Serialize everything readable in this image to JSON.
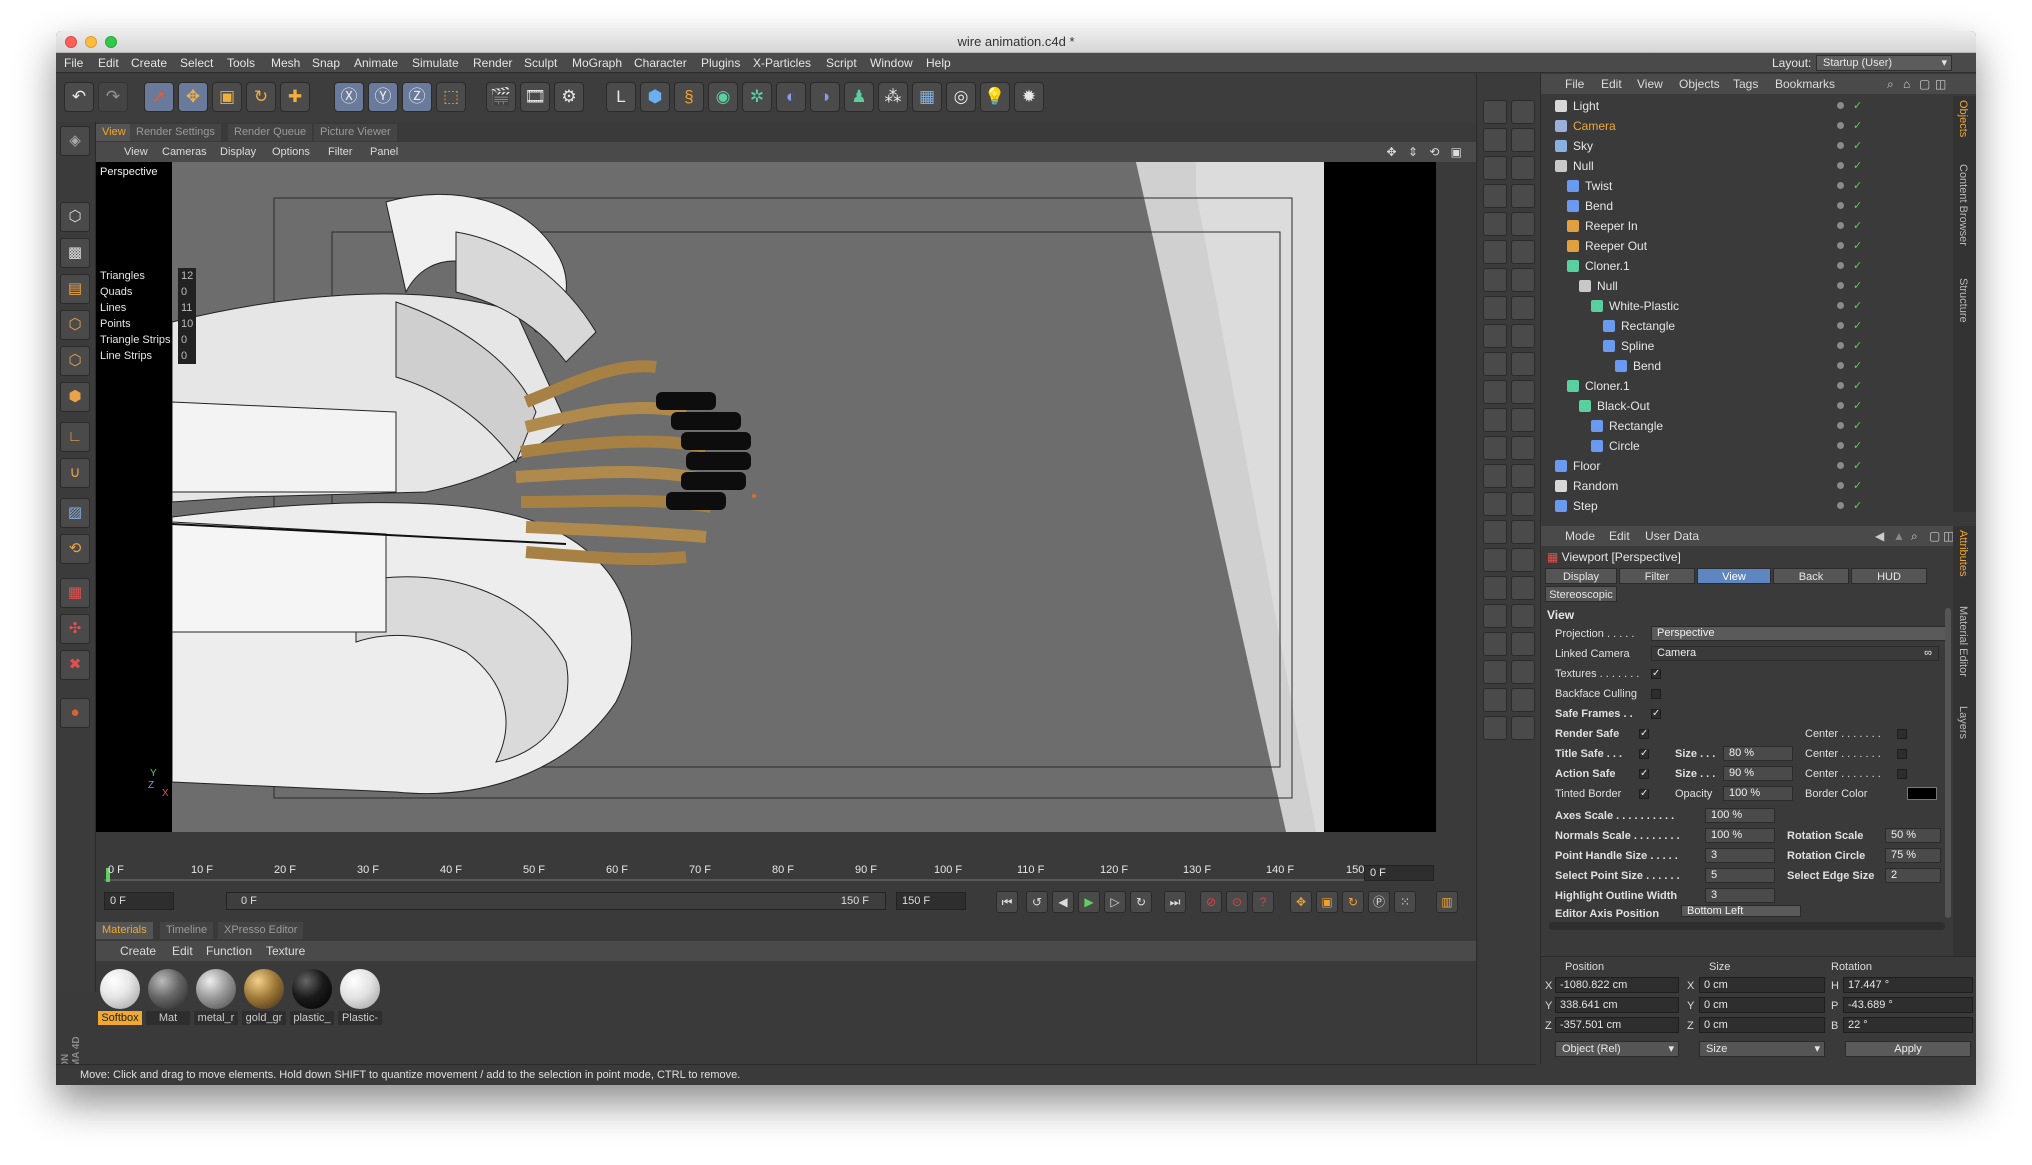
{
  "window": {
    "title": "wire animation.c4d *"
  },
  "menu": [
    "File",
    "Edit",
    "Create",
    "Select",
    "Tools",
    "Mesh",
    "Snap",
    "Animate",
    "Simulate",
    "Render",
    "Sculpt",
    "MoGraph",
    "Character",
    "Plugins",
    "X-Particles",
    "Script",
    "Window",
    "Help"
  ],
  "layout": {
    "label": "Layout:",
    "value": "Startup (User)"
  },
  "viewport_tabs": [
    "View",
    "Render Settings",
    "Render Queue",
    "Picture Viewer"
  ],
  "viewport_menus": [
    "View",
    "Cameras",
    "Display",
    "Options",
    "Filter",
    "Panel"
  ],
  "viewport": {
    "label": "Perspective",
    "stats": [
      {
        "k": "Triangles",
        "v": "12"
      },
      {
        "k": "Quads",
        "v": "0"
      },
      {
        "k": "Lines",
        "v": "11"
      },
      {
        "k": "Points",
        "v": "10"
      },
      {
        "k": "Triangle Strips",
        "v": "0"
      },
      {
        "k": "Line Strips",
        "v": "0"
      }
    ],
    "axis_y": "Y",
    "axis_z": "Z",
    "axis_x": "X"
  },
  "timeline": {
    "ruler": [
      "0 F",
      "10 F",
      "20 F",
      "30 F",
      "40 F",
      "50 F",
      "60 F",
      "70 F",
      "80 F",
      "90 F",
      "100 F",
      "110 F",
      "120 F",
      "130 F",
      "140 F",
      "150"
    ],
    "current_frame": "0 F",
    "start": "0 F",
    "slider_start": "0 F",
    "slider_end": "150 F",
    "end": "150 F"
  },
  "materials": {
    "tabs": [
      "Materials",
      "Timeline",
      "XPresso Editor"
    ],
    "menus": [
      "Create",
      "Edit",
      "Function",
      "Texture"
    ],
    "items": [
      {
        "label": "Softbox",
        "color": "#e8e8e8"
      },
      {
        "label": "Mat",
        "color": "#666666"
      },
      {
        "label": "metal_r",
        "color": "#9a9a9a"
      },
      {
        "label": "gold_gr",
        "color": "#a07a3a"
      },
      {
        "label": "plastic_",
        "color": "#1a1a1a"
      },
      {
        "label": "Plastic-",
        "color": "#e2e2e2"
      }
    ]
  },
  "status": "Move: Click and drag to move elements. Hold down SHIFT to quantize movement / add to the selection in point mode, CTRL to remove.",
  "objects": {
    "menus": [
      "File",
      "Edit",
      "View",
      "Objects",
      "Tags",
      "Bookmarks"
    ],
    "side_tabs": [
      "Objects",
      "Content Browser",
      "Structure"
    ],
    "rows": [
      {
        "name": "Light",
        "level": 0,
        "orange": false,
        "icon": "#d8d8d8"
      },
      {
        "name": "Camera",
        "level": 0,
        "orange": true,
        "icon": "#9ab0d8"
      },
      {
        "name": "Sky",
        "level": 0,
        "orange": false,
        "icon": "#8ab0e0"
      },
      {
        "name": "Null",
        "level": 0,
        "orange": false,
        "icon": "#c8c8c8"
      },
      {
        "name": "Twist",
        "level": 1,
        "orange": false,
        "icon": "#6a9af0"
      },
      {
        "name": "Bend",
        "level": 1,
        "orange": false,
        "icon": "#6a9af0"
      },
      {
        "name": "Reeper  In",
        "level": 1,
        "orange": false,
        "icon": "#e0a040"
      },
      {
        "name": "Reeper Out",
        "level": 1,
        "orange": false,
        "icon": "#e0a040"
      },
      {
        "name": "Cloner.1",
        "level": 1,
        "orange": false,
        "icon": "#5ad0a0"
      },
      {
        "name": "Null",
        "level": 2,
        "orange": false,
        "icon": "#c8c8c8"
      },
      {
        "name": "White-Plastic",
        "level": 3,
        "orange": false,
        "icon": "#5ad0a0"
      },
      {
        "name": "Rectangle",
        "level": 4,
        "orange": false,
        "icon": "#6a9af0"
      },
      {
        "name": "Spline",
        "level": 4,
        "orange": false,
        "icon": "#6a9af0"
      },
      {
        "name": "Bend",
        "level": 5,
        "orange": false,
        "icon": "#6a9af0"
      },
      {
        "name": "Cloner.1",
        "level": 1,
        "orange": false,
        "icon": "#5ad0a0"
      },
      {
        "name": "Black-Out",
        "level": 2,
        "orange": false,
        "icon": "#5ad0a0"
      },
      {
        "name": "Rectangle",
        "level": 3,
        "orange": false,
        "icon": "#6a9af0"
      },
      {
        "name": "Circle",
        "level": 3,
        "orange": false,
        "icon": "#6a9af0"
      },
      {
        "name": "Floor",
        "level": 0,
        "orange": false,
        "icon": "#6a9af0"
      },
      {
        "name": "Random",
        "level": 0,
        "orange": false,
        "icon": "#d8d8d8"
      },
      {
        "name": "Step",
        "level": 0,
        "orange": false,
        "icon": "#6a9af0"
      }
    ]
  },
  "attributes": {
    "menus": [
      "Mode",
      "Edit",
      "User Data"
    ],
    "title": "Viewport [Perspective]",
    "tabs": [
      "Display",
      "Filter",
      "View",
      "Back",
      "HUD"
    ],
    "tab2": "Stereoscopic",
    "section": "View",
    "side_tabs": [
      "Attributes",
      "Material Editor",
      "Layers"
    ],
    "projection_label": "Projection . . . . .",
    "projection": "Perspective",
    "linked_camera_label": "Linked Camera",
    "linked_camera": "Camera",
    "textures": "Textures . . . . . . .",
    "backface": "Backface Culling",
    "safe_frames": "Safe Frames . .",
    "render_safe": "Render Safe",
    "title_safe": "Title Safe . . .",
    "action_safe": "Action Safe",
    "tinted_border": "Tinted Border",
    "center": "Center . . . . . . .",
    "size_label": "Size . . .",
    "size_title": "80 %",
    "size_action": "90 %",
    "opacity_label": "Opacity",
    "opacity": "100 %",
    "border_color": "Border Color",
    "axes_scale_label": "Axes Scale . . . . . . . . . .",
    "axes_scale": "100 %",
    "normals_scale_label": "Normals Scale . . . . . . . .",
    "normals_scale": "100 %",
    "rotation_scale_label": "Rotation Scale",
    "rotation_scale": "50 %",
    "point_handle_label": "Point Handle Size . . . . .",
    "point_handle": "3",
    "rotation_circle_label": "Rotation Circle",
    "rotation_circle": "75 %",
    "select_point_label": "Select Point Size . . . . . .",
    "select_point": "5",
    "select_edge_label": "Select Edge Size",
    "select_edge": "2",
    "highlight_label": "Highlight Outline Width",
    "highlight": "3",
    "editor_axis_label": "Editor Axis Position",
    "editor_axis": "Bottom Left"
  },
  "coords": {
    "heads": [
      "Position",
      "Size",
      "Rotation"
    ],
    "rows": [
      {
        "axis": "X",
        "pos": "-1080.822 cm",
        "saxis": "X",
        "size": "0 cm",
        "raxis": "H",
        "rot": "17.447 °"
      },
      {
        "axis": "Y",
        "pos": "338.641 cm",
        "saxis": "Y",
        "size": "0 cm",
        "raxis": "P",
        "rot": "-43.689 °"
      },
      {
        "axis": "Z",
        "pos": "-357.501 cm",
        "saxis": "Z",
        "size": "0 cm",
        "raxis": "B",
        "rot": "22 °"
      }
    ],
    "mode": "Object (Rel)",
    "size_mode": "Size",
    "apply": "Apply"
  }
}
